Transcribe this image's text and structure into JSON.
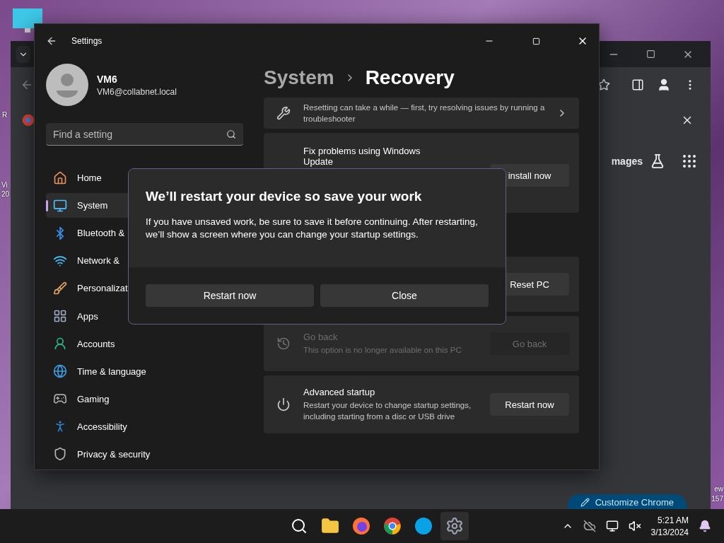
{
  "desktop": {
    "labels": [
      "R",
      "Vi",
      "20",
      "ew",
      "157"
    ]
  },
  "browser": {
    "partial_link": "mages",
    "customize_button": "Customize Chrome"
  },
  "settings": {
    "window_title": "Settings",
    "user": {
      "name": "VM6",
      "email": "VM6@collabnet.local"
    },
    "search": {
      "placeholder": "Find a setting"
    },
    "nav": [
      {
        "label": "Home",
        "selected": false
      },
      {
        "label": "System",
        "selected": true
      },
      {
        "label": "Bluetooth &",
        "selected": false
      },
      {
        "label": "Network &",
        "selected": false
      },
      {
        "label": "Personalizat",
        "selected": false
      },
      {
        "label": "Apps",
        "selected": false
      },
      {
        "label": "Accounts",
        "selected": false
      },
      {
        "label": "Time & language",
        "selected": false
      },
      {
        "label": "Gaming",
        "selected": false
      },
      {
        "label": "Accessibility",
        "selected": false
      },
      {
        "label": "Privacy & security",
        "selected": false
      }
    ],
    "breadcrumb": [
      "System",
      "Recovery"
    ],
    "card_groups": [
      {
        "cards": [
          {
            "kind": "link",
            "description": "Resetting can take a while — first, try resolving issues by running a troubleshooter"
          },
          {
            "kind": "action",
            "title": "Fix problems using Windows Update",
            "button": "install now",
            "disabled": false
          }
        ]
      },
      {
        "cards": [
          {
            "kind": "action",
            "button": "Reset PC",
            "disabled": false
          },
          {
            "kind": "action",
            "title": "Go back",
            "description": "This option is no longer available on this PC",
            "button": "Go back",
            "disabled": true
          },
          {
            "kind": "action",
            "title": "Advanced startup",
            "description": "Restart your device to change startup settings, including starting from a disc or USB drive",
            "button": "Restart now",
            "disabled": false
          }
        ]
      }
    ]
  },
  "dialog": {
    "title": "We’ll restart your device so save your work",
    "message": "If you have unsaved work, be sure to save it before continuing. After restarting, we’ll show a screen where you can change your startup settings.",
    "buttons": [
      "Restart now",
      "Close"
    ]
  },
  "taskbar": {
    "apps": [
      {
        "active": false
      },
      {
        "active": false
      },
      {
        "active": false
      },
      {
        "active": false
      },
      {
        "active": false
      },
      {
        "active": true
      }
    ],
    "time": "5:21 AM",
    "date": "3/13/2024"
  }
}
